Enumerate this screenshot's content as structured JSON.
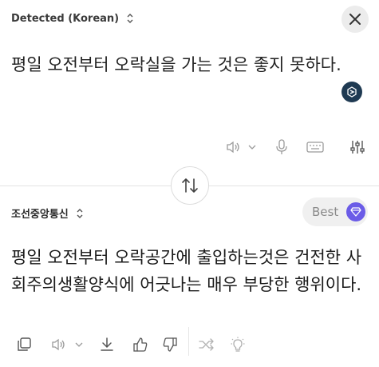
{
  "source": {
    "language_label": "Detected (Korean)",
    "text": "평일 오전부터 오락실을 가는 것은 좋지 못하다."
  },
  "target": {
    "language_label": "조선중앙통신",
    "best_label": "Best",
    "text": "평일 오전부터 오락공간에 출입하는것은 건전한 사회주의생활양식에 어긋나는 매우 부당한 행위이다."
  },
  "icons": {
    "close": "close-icon",
    "fab": "assistant-icon",
    "speaker": "speaker-icon",
    "mic": "microphone-icon",
    "keyboard": "keyboard-icon",
    "settings": "sliders-icon",
    "swap": "swap-icon",
    "copy": "copy-icon",
    "download": "download-icon",
    "thumbs_up": "thumbs-up-icon",
    "thumbs_down": "thumbs-down-icon",
    "shuffle": "shuffle-icon",
    "lightbulb": "lightbulb-icon",
    "gem": "gem-icon"
  },
  "colors": {
    "accent_purple": "#6b5ce7",
    "fab_navy": "#1f3a52",
    "icon_gray": "#9a9a9a"
  }
}
